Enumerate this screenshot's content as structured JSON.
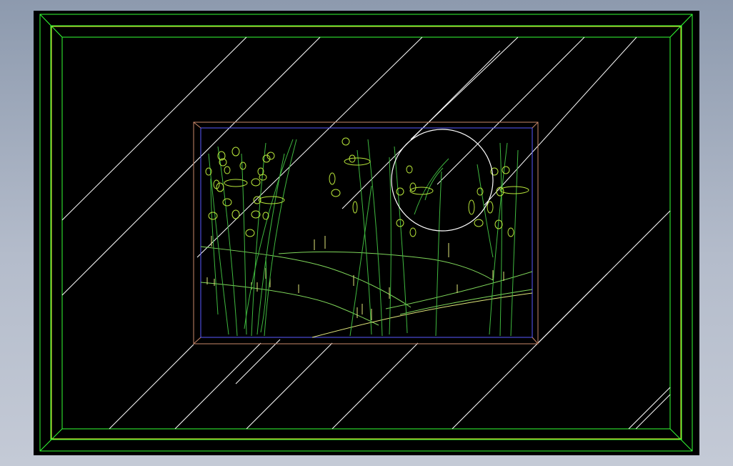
{
  "viewport": {
    "background": "#000000",
    "desktop_gradient": [
      "#8d9aae",
      "#c4cad6"
    ]
  },
  "colors": {
    "outer_frame": "#33ff33",
    "frame_accent": "#e6e633",
    "hatch": "#ffffff",
    "painting_outer": "#c8876a",
    "painting_inner": "#5a5aff",
    "reeds": "#3fb83f",
    "buds": "#b8e63a",
    "hills": "#7fd65a",
    "path_line": "#e0e67a",
    "moon": "#ffffff"
  },
  "drawing": {
    "name": "framed-painting-cad-drawing",
    "elements": [
      "outer-frame",
      "hatch-lines",
      "painting-frame",
      "reeds",
      "buds",
      "hills",
      "moon"
    ]
  }
}
